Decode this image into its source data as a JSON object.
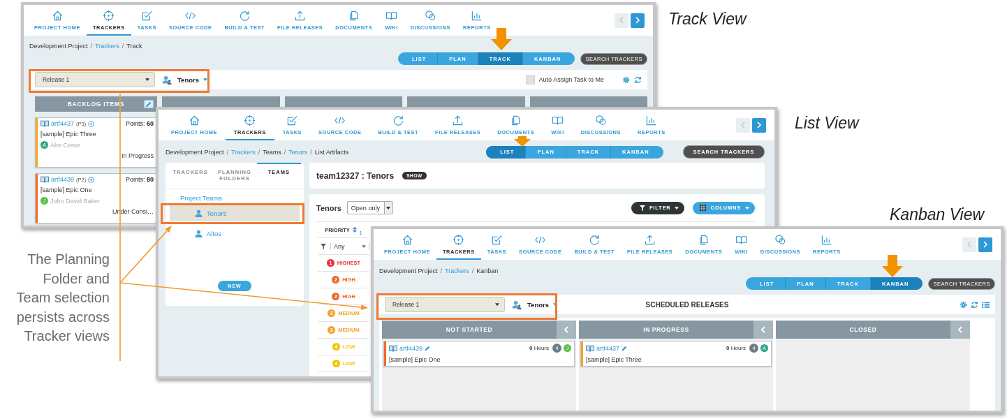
{
  "windows": [
    {
      "kind": "track",
      "view_label": "Track View",
      "nav": [
        {
          "label": "PROJECT HOME",
          "selected": false
        },
        {
          "label": "TRACKERS",
          "selected": true
        },
        {
          "label": "TASKS",
          "selected": false
        },
        {
          "label": "SOURCE CODE",
          "selected": false
        },
        {
          "label": "BUILD & TEST",
          "selected": false
        },
        {
          "label": "FILE RELEASES",
          "selected": false
        },
        {
          "label": "DOCUMENTS",
          "selected": false
        },
        {
          "label": "WIKI",
          "selected": false
        },
        {
          "label": "DISCUSSIONS",
          "selected": false
        },
        {
          "label": "REPORTS",
          "selected": false
        }
      ],
      "breadcrumb": [
        {
          "text": "Development Project",
          "kind": "text"
        },
        {
          "text": "/",
          "kind": "separator"
        },
        {
          "text": "Trackers",
          "kind": "link"
        },
        {
          "text": "/",
          "kind": "separator"
        },
        {
          "text": "Track",
          "kind": "text"
        }
      ],
      "view_tabs": [
        {
          "label": "LIST",
          "selected": false
        },
        {
          "label": "PLAN",
          "selected": false
        },
        {
          "label": "TRACK",
          "selected": true
        },
        {
          "label": "KANBAN",
          "selected": false
        }
      ],
      "search_button": "SEARCH TRACKERS",
      "release": "Release 1",
      "team": "Tenors",
      "auto_assign": {
        "label": "Auto Assign Task to Me",
        "checked": false
      },
      "backlog": {
        "title": "BACKLOG ITEMS",
        "cards": [
          {
            "id": "artf4437",
            "priority": "(P3)",
            "points": "Points: **60**",
            "title": "[sample] Epic Three",
            "avatar": {
              "initial": "A",
              "color": "#2fa58a"
            },
            "assignee": "Abe Cerne",
            "status": "In Progress",
            "color": "#f5a623"
          },
          {
            "id": "artf4439",
            "priority": "(P2)",
            "points": "Points: **80**",
            "title": "[sample] Epic One",
            "avatar": {
              "initial": "J",
              "color": "#58c14a"
            },
            "assignee": "John David Baker",
            "status": "Under Consi…",
            "color": "#f06a2a"
          }
        ]
      }
    },
    {
      "kind": "list",
      "view_label": "List View",
      "nav": [
        {
          "label": "PROJECT HOME",
          "selected": false
        },
        {
          "label": "TRACKERS",
          "selected": true
        },
        {
          "label": "TASKS",
          "selected": false
        },
        {
          "label": "SOURCE CODE",
          "selected": false
        },
        {
          "label": "BUILD & TEST",
          "selected": false
        },
        {
          "label": "FILE RELEASES",
          "selected": false
        },
        {
          "label": "DOCUMENTS",
          "selected": false
        },
        {
          "label": "WIKI",
          "selected": false
        },
        {
          "label": "DISCUSSIONS",
          "selected": false
        },
        {
          "label": "REPORTS",
          "selected": false
        }
      ],
      "breadcrumb": [
        {
          "text": "Development Project",
          "kind": "text"
        },
        {
          "text": "/",
          "kind": "separator"
        },
        {
          "text": "Trackers",
          "kind": "link"
        },
        {
          "text": "/",
          "kind": "separator"
        },
        {
          "text": "Teams",
          "kind": "text"
        },
        {
          "text": "/",
          "kind": "separator"
        },
        {
          "text": "Tenors",
          "kind": "link"
        },
        {
          "text": "/",
          "kind": "separator"
        },
        {
          "text": "List Artifacts",
          "kind": "text"
        }
      ],
      "view_tabs": [
        {
          "label": "LIST",
          "selected": true
        },
        {
          "label": "PLAN",
          "selected": false
        },
        {
          "label": "TRACK",
          "selected": false
        },
        {
          "label": "KANBAN",
          "selected": false
        }
      ],
      "search_button": "SEARCH TRACKERS",
      "side_tabs": [
        {
          "label": "TRACKERS",
          "selected": false
        },
        {
          "label": "PLANNING FOLDERS",
          "selected": false
        },
        {
          "label": "TEAMS",
          "selected": true
        }
      ],
      "teams_heading": "Project Teams",
      "teams": [
        {
          "name": "Tenors",
          "selected": true
        },
        {
          "name": "Altos",
          "selected": false
        }
      ],
      "new_button": "NEW",
      "team_title": "team12327 : Tenors",
      "show_badge": "SHOW",
      "list_title": "Tenors",
      "status_filter": "Open only",
      "filter_button": "FILTER",
      "columns_button": "COLUMNS",
      "priority_header": "PRIORITY",
      "sort_index": "1",
      "filter_value": "Any",
      "priorities": [
        {
          "number": "1",
          "label": "HIGHEST",
          "color": "#e8333a"
        },
        {
          "number": "2",
          "label": "HIGH",
          "color": "#f0692c"
        },
        {
          "number": "2",
          "label": "HIGH",
          "color": "#f0692c"
        },
        {
          "number": "3",
          "label": "MEDIUM",
          "color": "#f5a02e"
        },
        {
          "number": "3",
          "label": "MEDIUM",
          "color": "#f5a02e"
        },
        {
          "number": "4",
          "label": "LOW",
          "color": "#f2c500"
        },
        {
          "number": "4",
          "label": "LOW",
          "color": "#f2c500"
        }
      ]
    },
    {
      "kind": "kanban",
      "view_label": "Kanban View",
      "nav": [
        {
          "label": "PROJECT HOME",
          "selected": false
        },
        {
          "label": "TRACKERS",
          "selected": true
        },
        {
          "label": "TASKS",
          "selected": false
        },
        {
          "label": "SOURCE CODE",
          "selected": false
        },
        {
          "label": "BUILD & TEST",
          "selected": false
        },
        {
          "label": "FILE RELEASES",
          "selected": false
        },
        {
          "label": "DOCUMENTS",
          "selected": false
        },
        {
          "label": "WIKI",
          "selected": false
        },
        {
          "label": "DISCUSSIONS",
          "selected": false
        },
        {
          "label": "REPORTS",
          "selected": false
        }
      ],
      "breadcrumb": [
        {
          "text": "Development Project",
          "kind": "text"
        },
        {
          "text": "/",
          "kind": "separator"
        },
        {
          "text": "Trackers",
          "kind": "link"
        },
        {
          "text": "/",
          "kind": "separator"
        },
        {
          "text": "Kanban",
          "kind": "text"
        }
      ],
      "view_tabs": [
        {
          "label": "LIST",
          "selected": false
        },
        {
          "label": "PLAN",
          "selected": false
        },
        {
          "label": "TRACK",
          "selected": false
        },
        {
          "label": "KANBAN",
          "selected": true
        }
      ],
      "search_button": "SEARCH TRACKERS",
      "release": "Release 1",
      "team": "Tenors",
      "board_title": "SCHEDULED RELEASES",
      "columns": [
        {
          "title": "NOT STARTED",
          "cards": [
            {
              "id": "artf4439",
              "hours": "**0** Hours",
              "estimate": "4",
              "avatar": {
                "initial": "J",
                "color": "#58c14a"
              },
              "title": "[sample] Epic One",
              "color": "#f06a2a"
            }
          ]
        },
        {
          "title": "IN PROGRESS",
          "cards": [
            {
              "id": "artf4437",
              "hours": "**0** Hours",
              "estimate": "4",
              "avatar": {
                "initial": "A",
                "color": "#2fa58a"
              },
              "title": "[sample] Epic Three",
              "color": "#f5a623"
            }
          ]
        },
        {
          "title": "CLOSED"
        }
      ]
    }
  ],
  "caption": "The Planning Folder and Team selection persists across Tracker views"
}
